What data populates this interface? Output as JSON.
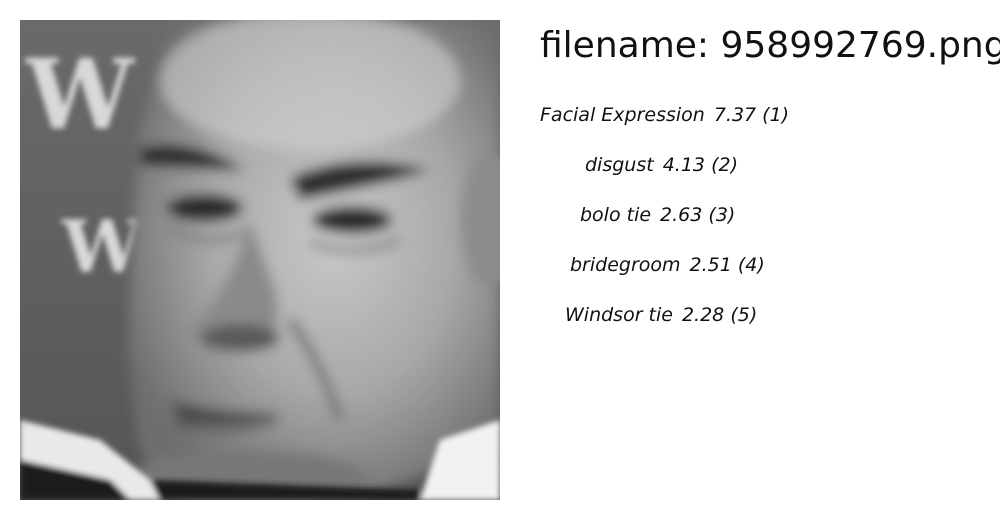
{
  "image": {
    "description": "grayscale close-up face photo",
    "background_letters": [
      "W",
      "W"
    ]
  },
  "filename_label": "filename: 958992769.png",
  "predictions": [
    {
      "label": "Facial Expression",
      "score": "7.37",
      "rank": "(1)"
    },
    {
      "label": "disgust",
      "score": "4.13",
      "rank": "(2)"
    },
    {
      "label": "bolo tie",
      "score": "2.63",
      "rank": "(3)"
    },
    {
      "label": "bridegroom",
      "score": "2.51",
      "rank": "(4)"
    },
    {
      "label": "Windsor tie",
      "score": "2.28",
      "rank": "(5)"
    }
  ]
}
